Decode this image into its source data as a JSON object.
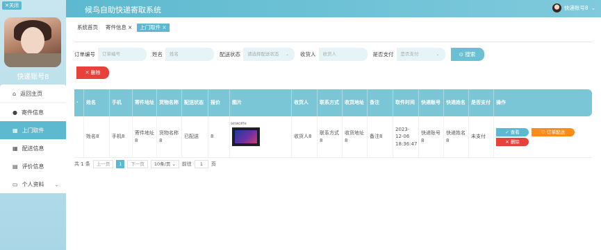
{
  "sidebar": {
    "close_label": "✕关闭",
    "account_name": "快递账号8",
    "items": [
      {
        "label": "返回主页",
        "icon": "home-icon"
      },
      {
        "label": "寄件信息",
        "icon": "user-icon"
      },
      {
        "label": "上门取件",
        "icon": "grid-icon"
      },
      {
        "label": "配送信息",
        "icon": "grid-icon"
      },
      {
        "label": "评价信息",
        "icon": "doc-icon"
      },
      {
        "label": "个人资料",
        "icon": "user-card-icon"
      }
    ]
  },
  "header": {
    "title": "候鸟自助快递寄取系统",
    "user_label": "快递账号8"
  },
  "tabs": [
    {
      "label": "系统首页"
    },
    {
      "label": "寄件信息",
      "close": "×"
    },
    {
      "label": "上门取件",
      "close": "×"
    }
  ],
  "filters": {
    "order_no": {
      "label": "订单编号",
      "placeholder": "订单编号"
    },
    "name": {
      "label": "姓名",
      "placeholder": "姓名"
    },
    "status": {
      "label": "配送状态",
      "placeholder": "请选择配送状态"
    },
    "recipient": {
      "label": "收货人",
      "placeholder": "收货人"
    },
    "paid": {
      "label": "是否支付",
      "placeholder": "是否支付"
    },
    "search_label": "搜索"
  },
  "delete_label": "删除",
  "table": {
    "headers": [
      "姓名",
      "手机",
      "寄件地址",
      "货物名称",
      "配送状态",
      "报价",
      "图片",
      "收货人",
      "联系方式",
      "收货地址",
      "备注",
      "取件时间",
      "快递账号",
      "快递姓名",
      "是否支付",
      "操作"
    ],
    "rows": [
      {
        "name": "姓名8",
        "phone": "手机8",
        "send_address": "寄件地址8",
        "goods": "货物名称8",
        "status": "已配送",
        "price": "8",
        "image_brand": "SKYWORTH",
        "recipient": "收货人8",
        "contact": "联系方式8",
        "recv_address": "收货地址8",
        "remark": "备注8",
        "pickup_time": "2023-12-06 18:36:47",
        "courier_account": "快递账号8",
        "courier_name": "快递姓名8",
        "paid": "未支付",
        "view_label": "查看",
        "deliver_label": "订单配送",
        "row_delete_label": "删除"
      }
    ]
  },
  "pager": {
    "total": "共 1 条",
    "prev": "上一页",
    "page": "1",
    "next": "下一页",
    "size": "10条/页",
    "goto": "前往",
    "goto_page": "1",
    "page_suffix": "页"
  }
}
